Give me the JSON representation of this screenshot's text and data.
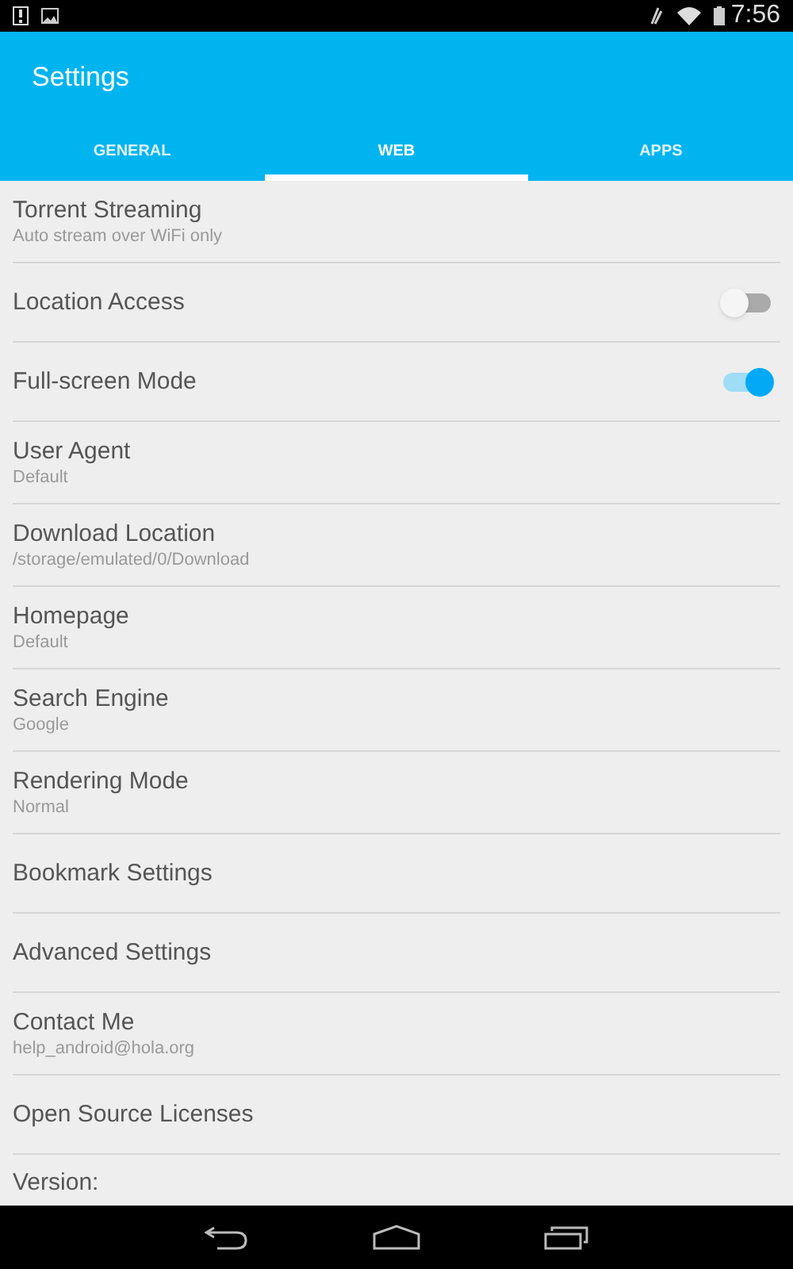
{
  "status_bar": {
    "time": "7:56"
  },
  "app_bar": {
    "title": "Settings"
  },
  "tabs": [
    {
      "label": "GENERAL",
      "selected": false
    },
    {
      "label": "WEB",
      "selected": true
    },
    {
      "label": "APPS",
      "selected": false
    }
  ],
  "settings": [
    {
      "kind": "text",
      "title": "Torrent Streaming",
      "summary": "Auto stream over WiFi only"
    },
    {
      "kind": "switch",
      "title": "Location Access",
      "on": false
    },
    {
      "kind": "switch",
      "title": "Full-screen Mode",
      "on": true
    },
    {
      "kind": "text",
      "title": "User Agent",
      "summary": "Default"
    },
    {
      "kind": "text",
      "title": "Download Location",
      "summary": "/storage/emulated/0/Download"
    },
    {
      "kind": "text",
      "title": "Homepage",
      "summary": "Default"
    },
    {
      "kind": "text",
      "title": "Search Engine",
      "summary": "Google"
    },
    {
      "kind": "text",
      "title": "Rendering Mode",
      "summary": "Normal"
    },
    {
      "kind": "text",
      "title": "Bookmark Settings"
    },
    {
      "kind": "text",
      "title": "Advanced Settings"
    },
    {
      "kind": "text",
      "title": "Contact Me",
      "summary": "help_android@hola.org"
    },
    {
      "kind": "text",
      "title": "Open Source Licenses"
    },
    {
      "kind": "text",
      "title": "Version:"
    }
  ]
}
